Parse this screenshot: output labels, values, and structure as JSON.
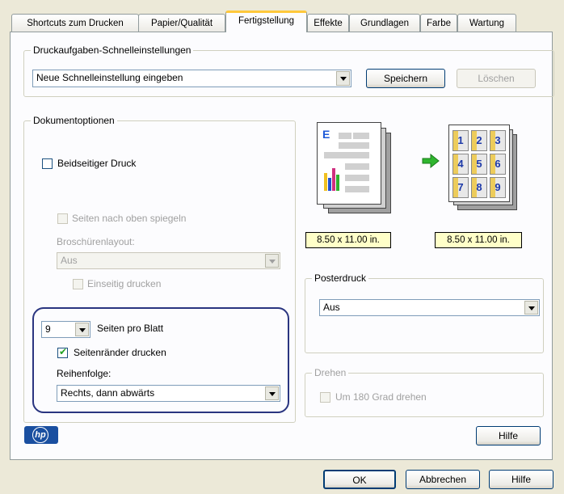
{
  "tabs": [
    "Shortcuts zum Drucken",
    "Papier/Qualität",
    "Fertigstellung",
    "Effekte",
    "Grundlagen",
    "Farbe",
    "Wartung"
  ],
  "quick": {
    "legend": "Druckaufgaben-Schnelleinstellungen",
    "value": "Neue Schnelleinstellung eingeben",
    "save": "Speichern",
    "delete": "Löschen"
  },
  "doc": {
    "legend": "Dokumentoptionen",
    "duplex": "Beidseitiger Druck",
    "flip": "Seiten nach oben spiegeln",
    "booklet_label": "Broschürenlayout:",
    "booklet_value": "Aus",
    "onesided": "Einseitig drucken",
    "pages_value": "9",
    "pages_label": "Seiten pro Blatt",
    "borders": "Seitenränder drucken",
    "borders_checked": true,
    "order_label": "Reihenfolge:",
    "order_value": "Rechts, dann abwärts"
  },
  "preview": {
    "left_size": "8.50 x 11.00 in.",
    "right_size": "8.50 x 11.00 in.",
    "grid": [
      "1",
      "2",
      "3",
      "4",
      "5",
      "6",
      "7",
      "8",
      "9"
    ],
    "page_letter": "E"
  },
  "poster": {
    "legend": "Posterdruck",
    "value": "Aus"
  },
  "rotate": {
    "legend": "Drehen",
    "option": "Um 180 Grad drehen"
  },
  "buttons": {
    "help_panel": "Hilfe",
    "ok": "OK",
    "cancel": "Abbrechen",
    "help": "Hilfe"
  },
  "logo": "hp",
  "colors": {
    "highlight_oval": "#2a3580",
    "arrow": "#2fb52f",
    "tab_accent": "#ffc83c",
    "size_box": "#ffffc8"
  }
}
